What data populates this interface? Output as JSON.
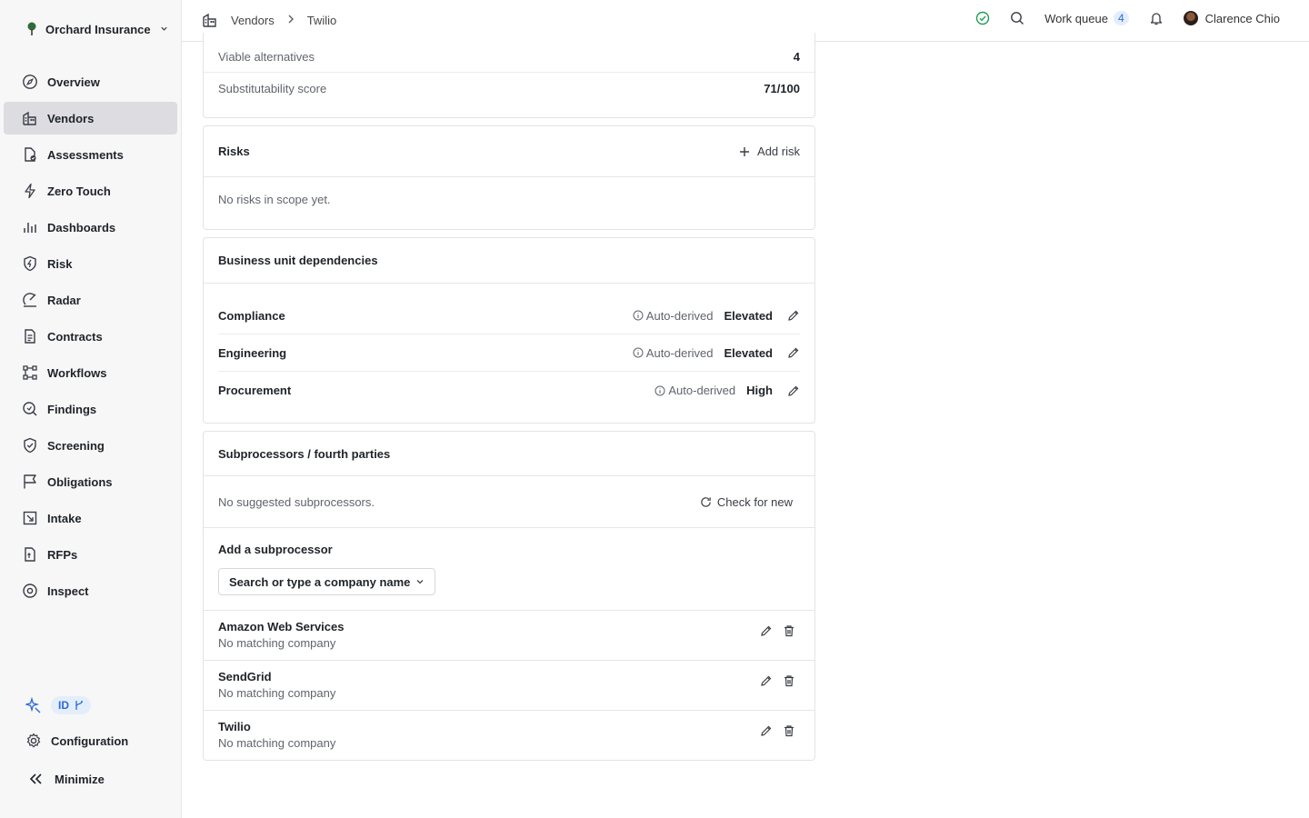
{
  "org": {
    "name": "Orchard Insurance"
  },
  "nav": [
    {
      "label": "Overview",
      "icon": "compass-icon"
    },
    {
      "label": "Vendors",
      "icon": "building-icon",
      "active": true
    },
    {
      "label": "Assessments",
      "icon": "document-check-icon"
    },
    {
      "label": "Zero Touch",
      "icon": "lightning-icon"
    },
    {
      "label": "Dashboards",
      "icon": "bar-chart-icon"
    },
    {
      "label": "Risk",
      "icon": "shield-bolt-icon"
    },
    {
      "label": "Radar",
      "icon": "radar-icon"
    },
    {
      "label": "Contracts",
      "icon": "contract-icon"
    },
    {
      "label": "Workflows",
      "icon": "workflow-icon"
    },
    {
      "label": "Findings",
      "icon": "findings-icon"
    },
    {
      "label": "Screening",
      "icon": "shield-check-icon"
    },
    {
      "label": "Obligations",
      "icon": "flag-icon"
    },
    {
      "label": "Intake",
      "icon": "intake-icon"
    },
    {
      "label": "RFPs",
      "icon": "rfp-icon"
    },
    {
      "label": "Inspect",
      "icon": "eye-icon"
    }
  ],
  "sidebar_bottom": {
    "id_label": "ID",
    "configuration": "Configuration",
    "minimize": "Minimize"
  },
  "breadcrumb": {
    "parent": "Vendors",
    "current": "Twilio"
  },
  "topbar": {
    "work_queue_label": "Work queue",
    "work_queue_count": "4",
    "user_name": "Clarence Chio"
  },
  "substitutability": {
    "rows": [
      {
        "label": "Viable alternatives",
        "value": "4"
      },
      {
        "label": "Substitutability score",
        "value": "71/100"
      }
    ]
  },
  "risks": {
    "title": "Risks",
    "add_label": "Add risk",
    "empty": "No risks in scope yet."
  },
  "bu_dependencies": {
    "title": "Business unit dependencies",
    "rows": [
      {
        "unit": "Compliance",
        "source": "Auto-derived",
        "level": "Elevated"
      },
      {
        "unit": "Engineering",
        "source": "Auto-derived",
        "level": "Elevated"
      },
      {
        "unit": "Procurement",
        "source": "Auto-derived",
        "level": "High"
      }
    ]
  },
  "subprocessors": {
    "title": "Subprocessors / fourth parties",
    "empty": "No suggested subprocessors.",
    "check_label": "Check for new",
    "add_title": "Add a subprocessor",
    "search_placeholder": "Search or type a company name",
    "items": [
      {
        "name": "Amazon Web Services",
        "status": "No matching company"
      },
      {
        "name": "SendGrid",
        "status": "No matching company"
      },
      {
        "name": "Twilio",
        "status": "No matching company"
      }
    ]
  },
  "colors": {
    "accent": "#2a6bd6",
    "status_ok": "#1f9d55",
    "active_nav_bg": "#dcdce1"
  }
}
